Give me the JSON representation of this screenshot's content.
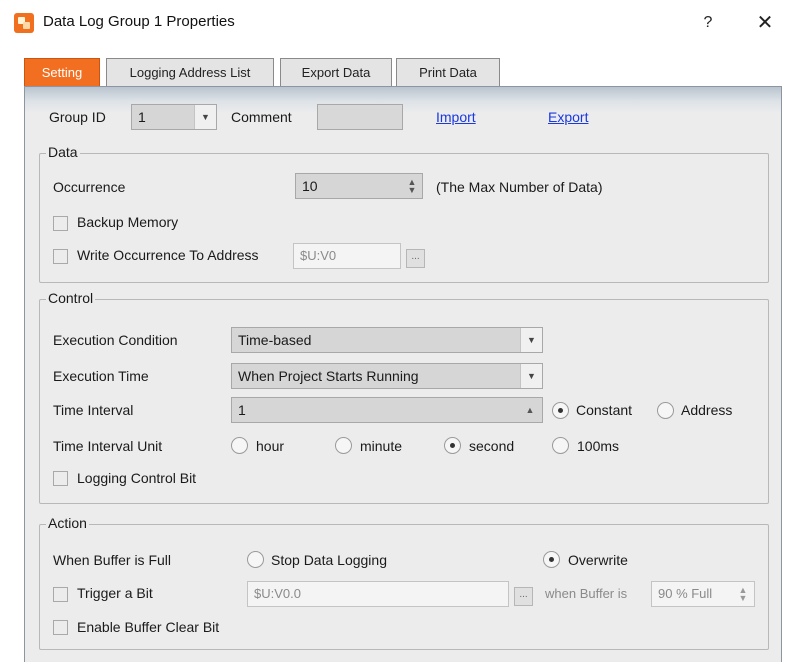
{
  "window": {
    "title": "Data Log Group 1 Properties",
    "help_label": "?",
    "close_label": "✕",
    "app_icon": "data-log-icon"
  },
  "tabs": [
    {
      "label": "Setting"
    },
    {
      "label": "Logging Address List"
    },
    {
      "label": "Export Data"
    },
    {
      "label": "Print Data"
    }
  ],
  "header_row": {
    "group_id_label": "Group ID",
    "group_id_value": "1",
    "comment_label": "Comment",
    "comment_value": "",
    "import_label": "Import",
    "export_label": "Export"
  },
  "data_group": {
    "legend": "Data",
    "occurrence_label": "Occurrence",
    "occurrence_value": "10",
    "occurrence_note": "(The Max Number of Data)",
    "backup_memory_label": "Backup Memory",
    "write_occurrence_label": "Write Occurrence To Address",
    "write_occurrence_address": "$U:V0",
    "ellipsis": "..."
  },
  "control_group": {
    "legend": "Control",
    "execution_condition_label": "Execution Condition",
    "execution_condition_value": "Time-based",
    "execution_time_label": "Execution Time",
    "execution_time_value": "When Project Starts Running",
    "time_interval_label": "Time Interval",
    "time_interval_value": "1",
    "constant_label": "Constant",
    "address_label": "Address",
    "time_interval_unit_label": "Time Interval Unit",
    "unit_options": [
      "hour",
      "minute",
      "second",
      "100ms"
    ],
    "selected_unit": "second",
    "logging_control_bit_label": "Logging Control Bit"
  },
  "action_group": {
    "legend": "Action",
    "when_buffer_full_label": "When Buffer is Full",
    "stop_data_logging_label": "Stop Data Logging",
    "overwrite_label": "Overwrite",
    "trigger_bit_label": "Trigger a Bit",
    "trigger_bit_address": "$U:V0.0",
    "ellipsis": "...",
    "when_buffer_is_label": "when Buffer is",
    "buffer_percent_value": "90 % Full",
    "enable_buffer_clear_label": "Enable Buffer Clear Bit"
  },
  "colors": {
    "active_tab": "#f26f21",
    "link": "#1a39e0"
  }
}
